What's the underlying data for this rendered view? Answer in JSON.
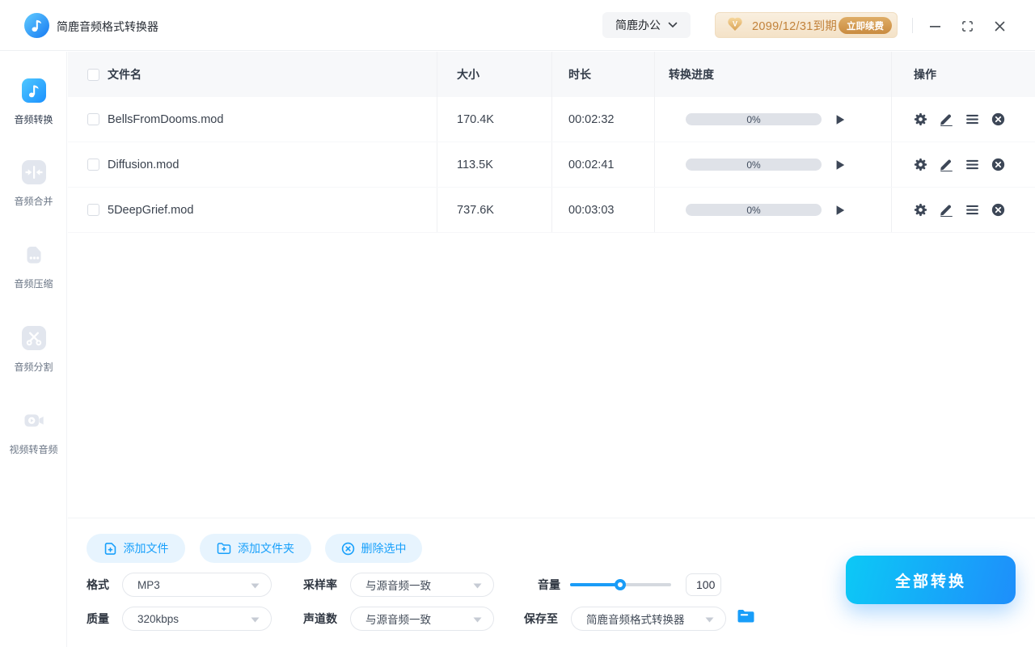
{
  "topbar": {
    "app_title": "简鹿音频格式转换器",
    "office_menu_label": "简鹿办公",
    "license": {
      "expiry_text": "2099/12/31到期",
      "renew_label": "立即续费"
    },
    "window_controls": {
      "minimize": "最小化",
      "maximize": "最大化",
      "close": "关闭"
    }
  },
  "sidebar": {
    "items": [
      {
        "label": "音频转换",
        "icon": "music-note-icon",
        "active": true
      },
      {
        "label": "音频合并",
        "icon": "merge-icon",
        "active": false
      },
      {
        "label": "音频压缩",
        "icon": "compress-file-icon",
        "active": false
      },
      {
        "label": "音频分割",
        "icon": "scissors-icon",
        "active": false
      },
      {
        "label": "视频转音频",
        "icon": "video-camera-icon",
        "active": false
      }
    ]
  },
  "table": {
    "headers": {
      "name": "文件名",
      "size": "大小",
      "duration": "时长",
      "progress": "转换进度",
      "actions": "操作"
    },
    "rows": [
      {
        "name": "BellsFromDooms.mod",
        "size": "170.4K",
        "duration": "00:02:32",
        "progress": "0%",
        "progress_value": 0
      },
      {
        "name": "Diffusion.mod",
        "size": "113.5K",
        "duration": "00:02:41",
        "progress": "0%",
        "progress_value": 0
      },
      {
        "name": "5DeepGrief.mod",
        "size": "737.6K",
        "duration": "00:03:03",
        "progress": "0%",
        "progress_value": 0
      }
    ],
    "row_action_icons": [
      "settings-gear-icon",
      "edit-pencil-icon",
      "list-icon",
      "remove-circle-icon"
    ]
  },
  "toolbar": {
    "add_file_label": "添加文件",
    "add_folder_label": "添加文件夹",
    "delete_selected_label": "删除选中"
  },
  "settings": {
    "format_label": "格式",
    "format_value": "MP3",
    "quality_label": "质量",
    "quality_value": "320kbps",
    "samplerate_label": "采样率",
    "samplerate_value": "与源音频一致",
    "channels_label": "声道数",
    "channels_value": "与源音频一致",
    "volume_label": "音量",
    "volume_value": "100",
    "volume_percent": 50,
    "saveto_label": "保存至",
    "saveto_value": "简鹿音频格式转换器"
  },
  "actions": {
    "convert_all_label": "全部转换"
  },
  "colors": {
    "primary_blue": "#1a9cf7",
    "button_light_blue_bg": "#e7f4fe",
    "convert_gradient": [
      "#0cc9f6",
      "#1e8efb"
    ],
    "active_icon_gradient": [
      "#4fc8ff",
      "#1b91ff"
    ],
    "inactive_icon_gray": "#e2e6ee",
    "progress_track_gray": "#dfe2e8",
    "vip_text_orange": "#c2823b",
    "renew_gradient": [
      "#dfad67",
      "#c98b3f"
    ],
    "table_header_bg": "#f7f8fa",
    "action_icon_slate": "#3d4757"
  }
}
